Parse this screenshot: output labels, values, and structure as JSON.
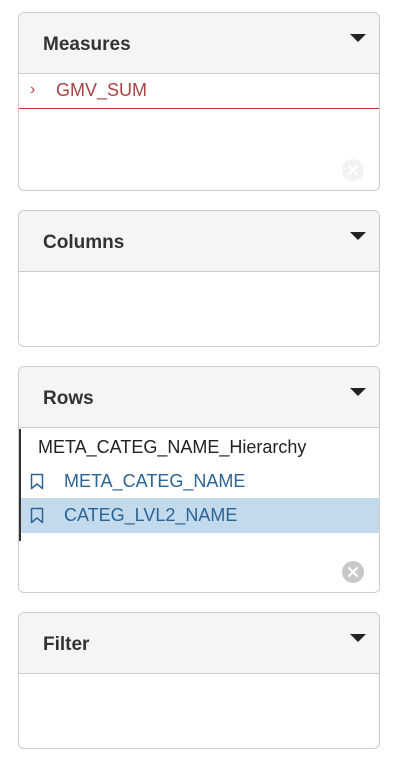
{
  "measures": {
    "title": "Measures",
    "items": [
      {
        "label": "GMV_SUM"
      }
    ]
  },
  "columns": {
    "title": "Columns"
  },
  "rows": {
    "title": "Rows",
    "hierarchy": "META_CATEG_NAME_Hierarchy",
    "levels": [
      {
        "label": "META_CATEG_NAME",
        "selected": false
      },
      {
        "label": "CATEG_LVL2_NAME",
        "selected": true
      }
    ]
  },
  "filter": {
    "title": "Filter"
  },
  "colors": {
    "measure_text": "#a94442",
    "level_text": "#2a6496",
    "selected_bg": "#c3daed",
    "header_bg": "#f5f5f5"
  }
}
